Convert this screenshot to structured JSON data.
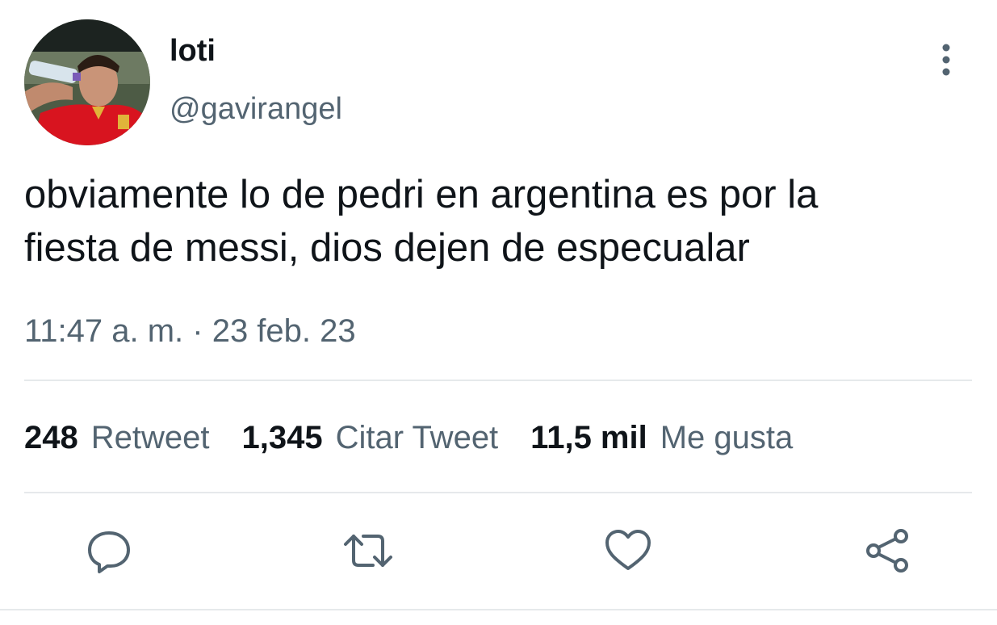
{
  "tweet": {
    "display_name": "loti",
    "handle": "@gavirangel",
    "text_lines": [
      "obviamente lo de pedri en argentina es por la",
      "ﬁesta de messi, dios dejen de especualar"
    ],
    "timestamp": "11:47 a. m. · 23 feb. 23"
  },
  "stats": {
    "retweets": {
      "count": "248",
      "label": "Retweet"
    },
    "quotes": {
      "count": "1,345",
      "label": "Citar Tweet"
    },
    "likes": {
      "count": "11,5 mil",
      "label": "Me gusta"
    }
  },
  "icons": {
    "avatar": "profile-photo",
    "more": "more-vertical-icon",
    "reply": "reply-icon",
    "retweet": "retweet-icon",
    "like": "heart-icon",
    "share": "share-icon"
  },
  "colors": {
    "primary_text": "#0f1419",
    "secondary_text": "#536471",
    "divider": "#e6e9eb"
  }
}
